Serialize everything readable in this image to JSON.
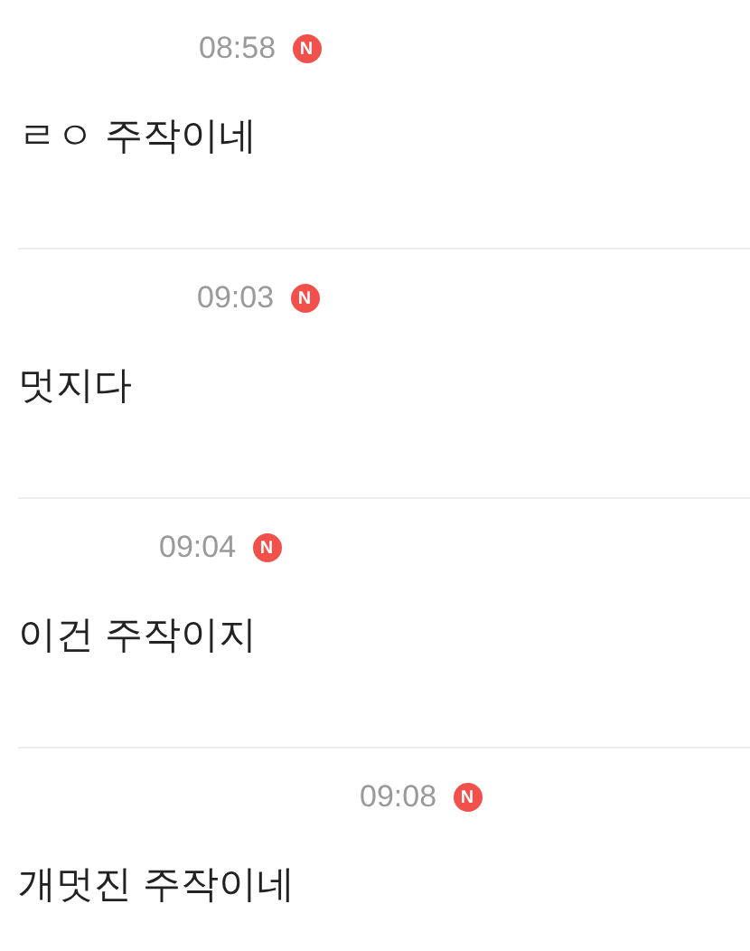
{
  "comments": [
    {
      "time": "08:58",
      "badge": "N",
      "text": "ㄹㅇ 주작이네"
    },
    {
      "time": "09:03",
      "badge": "N",
      "text": "멋지다"
    },
    {
      "time": "09:04",
      "badge": "N",
      "text": "이건 주작이지"
    },
    {
      "time": "09:08",
      "badge": "N",
      "text": "개멋진 주작이네"
    }
  ]
}
